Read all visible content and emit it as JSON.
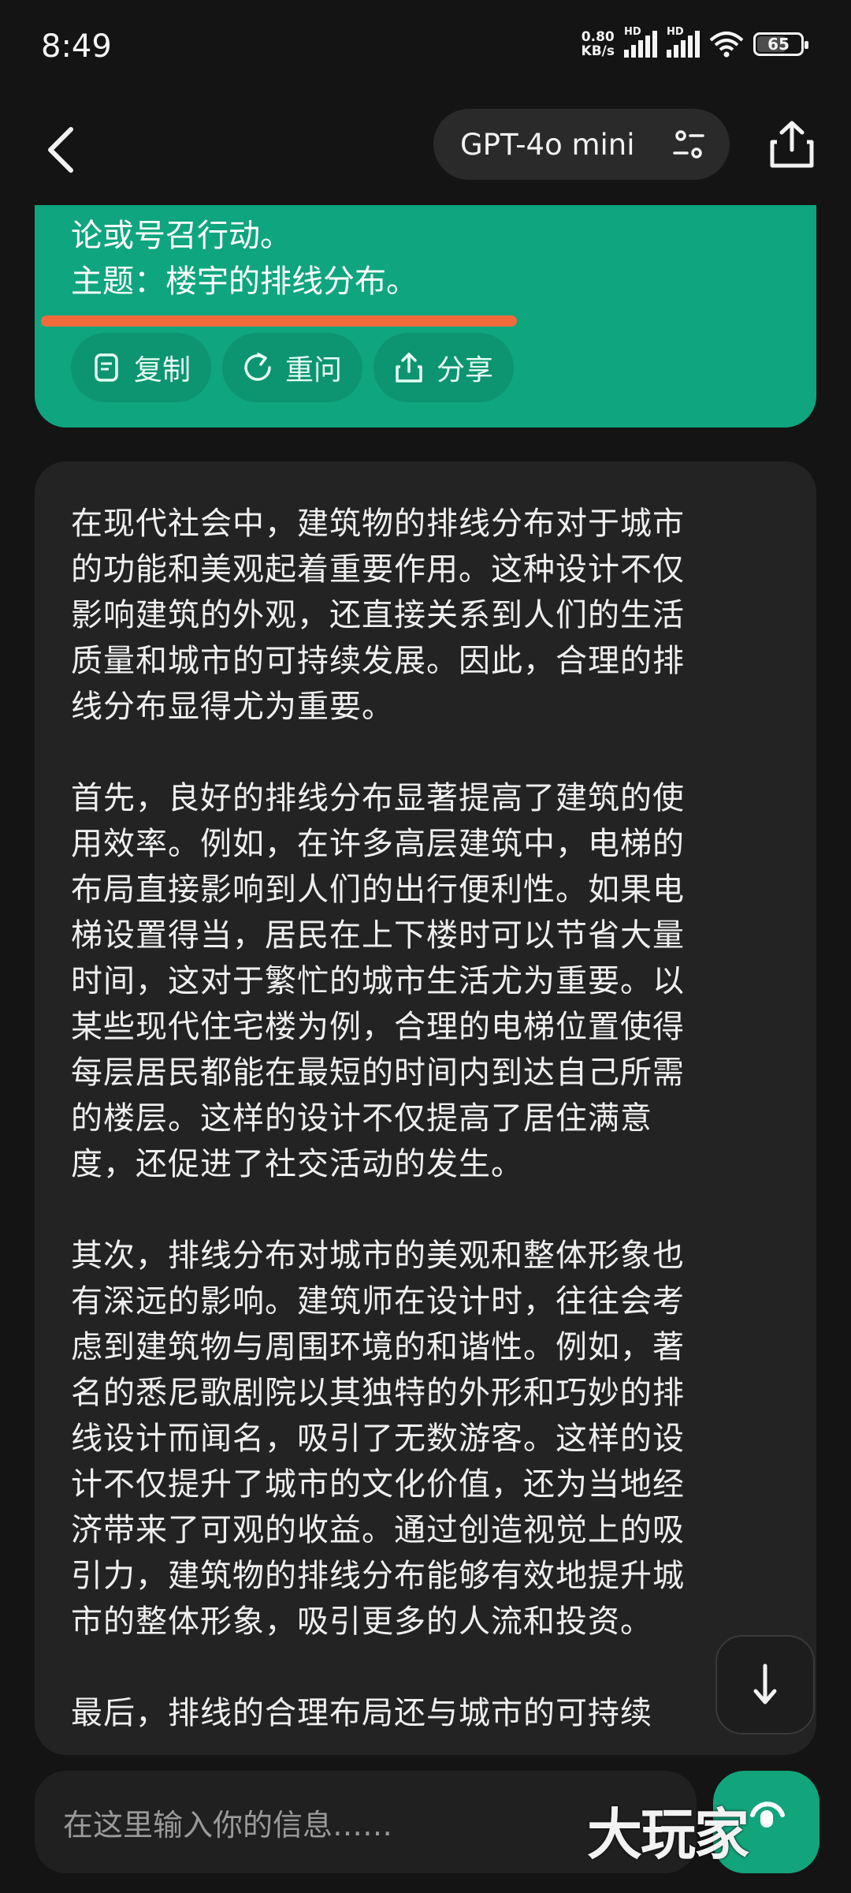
{
  "status_bar": {
    "time": "8:49",
    "net_speed_value": "0.80",
    "net_speed_unit": "KB/s",
    "signal1_label": "HD",
    "signal2_label": "HD",
    "battery": "65"
  },
  "header": {
    "model_name": "GPT-4o mini"
  },
  "user_message": {
    "lines": [
      "论或号召行动。",
      "主题：楼宇的排线分布。"
    ],
    "actions": {
      "copy": "复制",
      "retry": "重问",
      "share": "分享"
    }
  },
  "assistant_message": {
    "paragraphs": [
      [
        "在现代社会中，建筑物的排线分布对于城市",
        "的功能和美观起着重要作用。这种设计不仅",
        "影响建筑的外观，还直接关系到人们的生活",
        "质量和城市的可持续发展。因此，合理的排",
        "线分布显得尤为重要。"
      ],
      [
        "首先，良好的排线分布显著提高了建筑的使",
        "用效率。例如，在许多高层建筑中，电梯的",
        "布局直接影响到人们的出行便利性。如果电",
        "梯设置得当，居民在上下楼时可以节省大量",
        "时间，这对于繁忙的城市生活尤为重要。以",
        "某些现代住宅楼为例，合理的电梯位置使得",
        "每层居民都能在最短的时间内到达自己所需",
        "的楼层。这样的设计不仅提高了居住满意",
        "度，还促进了社交活动的发生。"
      ],
      [
        "其次，排线分布对城市的美观和整体形象也",
        "有深远的影响。建筑师在设计时，往往会考",
        "虑到建筑物与周围环境的和谐性。例如，著",
        "名的悉尼歌剧院以其独特的外形和巧妙的排",
        "线设计而闻名，吸引了无数游客。这样的设",
        "计不仅提升了城市的文化价值，还为当地经",
        "济带来了可观的收益。通过创造视觉上的吸",
        "引力，建筑物的排线分布能够有效地提升城",
        "市的整体形象，吸引更多的人流和投资。"
      ],
      [
        "最后，排线的合理布局还与城市的可持续"
      ]
    ]
  },
  "input_bar": {
    "placeholder": "在这里输入你的信息……"
  },
  "watermark": "大玩家",
  "colors": {
    "accent_green": "#0fa57e",
    "underline_orange": "#f06a3c",
    "background": "#141414",
    "card": "#232323"
  }
}
